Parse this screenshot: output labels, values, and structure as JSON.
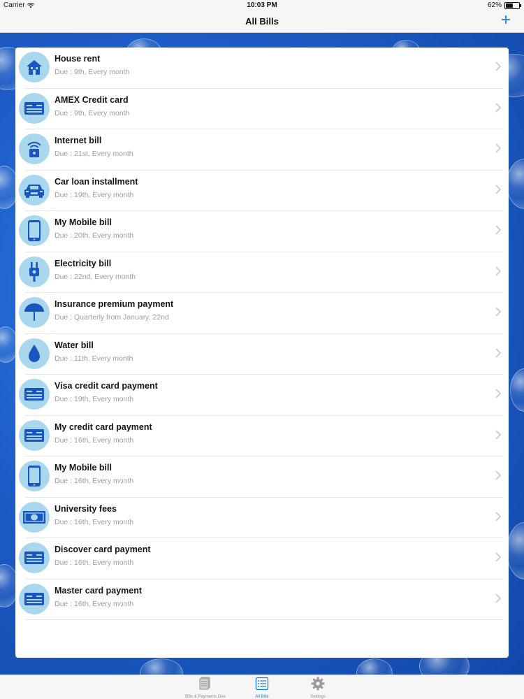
{
  "status_bar": {
    "carrier": "Carrier",
    "time": "10:03 PM",
    "battery": "62%",
    "battery_level": 0.62
  },
  "nav": {
    "title": "All Bills",
    "add_label": "+"
  },
  "bills": [
    {
      "name": "House rent",
      "due": "Due : 9th, Every month",
      "icon": "house-icon"
    },
    {
      "name": "AMEX Credit card",
      "due": "Due : 9th, Every month",
      "icon": "credit-card-icon"
    },
    {
      "name": "Internet bill",
      "due": "Due : 21st, Every month",
      "icon": "wifi-router-icon"
    },
    {
      "name": "Car loan installment",
      "due": "Due : 19th, Every month",
      "icon": "car-icon"
    },
    {
      "name": "My Mobile bill",
      "due": "Due : 20th, Every month",
      "icon": "mobile-phone-icon"
    },
    {
      "name": "Electricity bill",
      "due": "Due : 22nd, Every month",
      "icon": "power-plug-icon"
    },
    {
      "name": "Insurance premium payment",
      "due": "Due : Quarterly from January, 22nd",
      "icon": "umbrella-icon"
    },
    {
      "name": "Water bill",
      "due": "Due : 11th, Every month",
      "icon": "water-drop-icon"
    },
    {
      "name": "Visa credit card payment",
      "due": "Due : 19th, Every month",
      "icon": "credit-card-icon"
    },
    {
      "name": "My credit card payment",
      "due": "Due : 16th, Every month",
      "icon": "credit-card-icon"
    },
    {
      "name": "My Mobile bill",
      "due": "Due : 16th, Every month",
      "icon": "mobile-phone-icon"
    },
    {
      "name": "University fees",
      "due": "Due : 16th, Every month",
      "icon": "banknote-icon"
    },
    {
      "name": "Discover card payment",
      "due": "Due : 16th, Every month",
      "icon": "credit-card-icon"
    },
    {
      "name": "Master card payment",
      "due": "Due : 16th, Every month",
      "icon": "credit-card-icon"
    }
  ],
  "tabs": [
    {
      "label": "Bills & Payments Due",
      "icon": "documents-icon",
      "active": false
    },
    {
      "label": "All Bills",
      "icon": "list-icon",
      "active": true
    },
    {
      "label": "Settings",
      "icon": "gear-icon",
      "active": false
    }
  ],
  "colors": {
    "accent": "#1a7cf0",
    "icon_circle": "#a9d8ee",
    "icon_glyph": "#1a55c0",
    "background": "#1e5fc7"
  }
}
